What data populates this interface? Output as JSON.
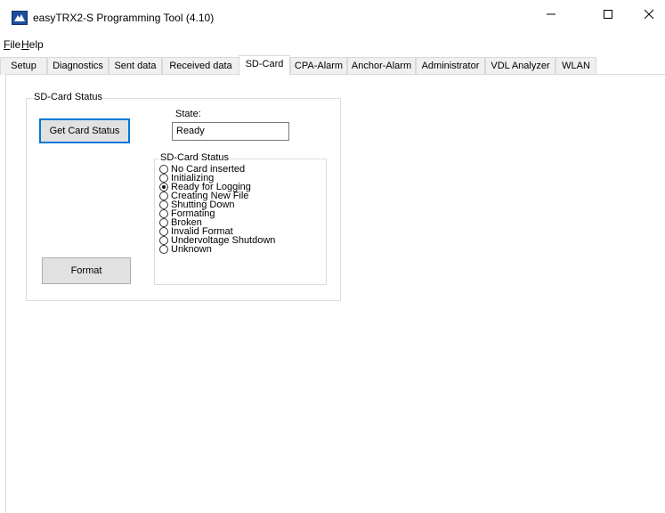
{
  "window": {
    "title": "easyTRX2-S Programming Tool  (4.10)",
    "minimize": "—",
    "maximize": "☐",
    "close": "✕"
  },
  "menu": {
    "file": {
      "accel": "F",
      "rest": "ile"
    },
    "help": {
      "accel": "H",
      "rest": "elp"
    }
  },
  "tabs": [
    "Setup",
    "Diagnostics",
    "Sent data",
    "Received data",
    "SD-Card",
    "CPA-Alarm",
    "Anchor-Alarm",
    "Administrator",
    "VDL Analyzer",
    "WLAN"
  ],
  "active_tab": "SD-Card",
  "sdcard": {
    "group_title": "SD-Card Status",
    "get_status_button": "Get Card Status",
    "format_button": "Format",
    "state_label": "State:",
    "state_value": "Ready",
    "status_group_title": "SD-Card Status",
    "statuses": [
      {
        "label": "No Card inserted",
        "checked": false
      },
      {
        "label": "Initializing",
        "checked": false
      },
      {
        "label": "Ready for Logging",
        "checked": true
      },
      {
        "label": "Creating New File",
        "checked": false
      },
      {
        "label": "Shutting Down",
        "checked": false
      },
      {
        "label": "Formating",
        "checked": false
      },
      {
        "label": "Broken",
        "checked": false
      },
      {
        "label": "Invalid Format",
        "checked": false
      },
      {
        "label": "Undervoltage Shutdown",
        "checked": false
      },
      {
        "label": "Unknown",
        "checked": false
      }
    ]
  }
}
